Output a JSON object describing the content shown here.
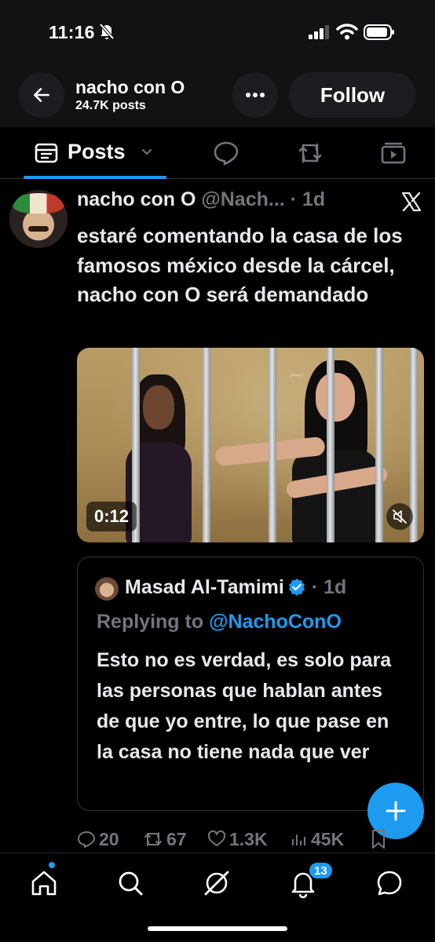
{
  "status_bar": {
    "time": "11:16"
  },
  "header": {
    "name": "nacho con O",
    "posts_count": "24.7K posts",
    "follow_label": "Follow"
  },
  "tabs": {
    "active_label": "Posts"
  },
  "post": {
    "author_name": "nacho con O",
    "author_handle": "@Nach...",
    "time": "· 1d",
    "text": "estaré comentando la casa de los famosos méxico desde la cárcel, nacho con O será demandado",
    "video": {
      "duration": "0:12"
    },
    "quote": {
      "author_name": "Masad Al-Tamimi",
      "time": "· 1d",
      "replying_prefix": "Replying to ",
      "replying_mention": "@NachoConO",
      "text": "Esto no es verdad, es solo para las personas que hablan antes de que yo entre, lo que pase en la casa no tiene nada que ver"
    },
    "stats": {
      "replies": "20",
      "reposts": "67",
      "likes": "1.3K",
      "views": "45K"
    }
  },
  "bottom_nav": {
    "notifications_badge": "13"
  },
  "colors": {
    "accent": "#1d9bf0",
    "background": "#000000",
    "muted": "#71767b"
  }
}
